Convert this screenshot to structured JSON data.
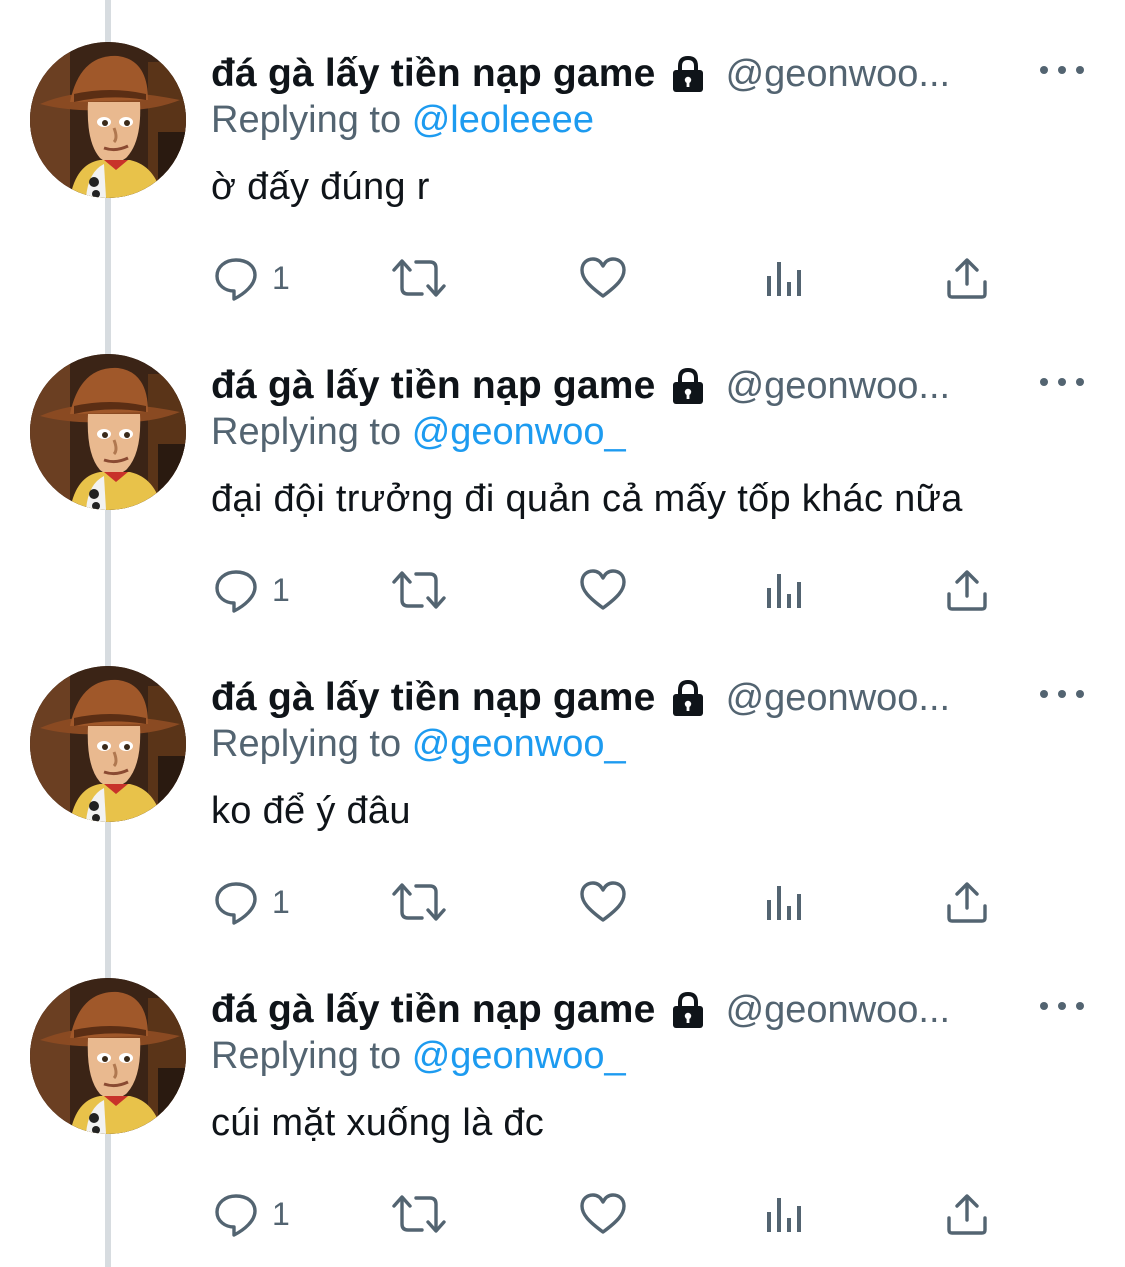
{
  "colors": {
    "accent": "#1d9bf0",
    "secondary_text": "#536471",
    "primary_text": "#0f1419"
  },
  "icons": {
    "more": "more-dots-icon",
    "protected": "lock-icon",
    "reply": "reply-bubble-icon",
    "retweet": "retweet-icon",
    "like": "heart-icon",
    "views": "analytics-bars-icon",
    "share": "share-upload-icon"
  },
  "tweets": [
    {
      "display_name": "đá gà lấy tiền nạp game",
      "handle": "@geonwoo...",
      "replying_prefix": "Replying to",
      "replying_to": "@leoleeee",
      "text": "ờ đấy đúng r",
      "reply_count": "1"
    },
    {
      "display_name": "đá gà lấy tiền nạp game",
      "handle": "@geonwoo...",
      "replying_prefix": "Replying to",
      "replying_to": "@geonwoo_",
      "text": "đại đội trưởng đi quản cả mấy tốp khác nữa",
      "reply_count": "1"
    },
    {
      "display_name": "đá gà lấy tiền nạp game",
      "handle": "@geonwoo...",
      "replying_prefix": "Replying to",
      "replying_to": "@geonwoo_",
      "text": "ko để ý đâu",
      "reply_count": "1"
    },
    {
      "display_name": "đá gà lấy tiền nạp game",
      "handle": "@geonwoo...",
      "replying_prefix": "Replying to",
      "replying_to": "@geonwoo_",
      "text": "cúi mặt xuống là đc",
      "reply_count": "1"
    }
  ]
}
